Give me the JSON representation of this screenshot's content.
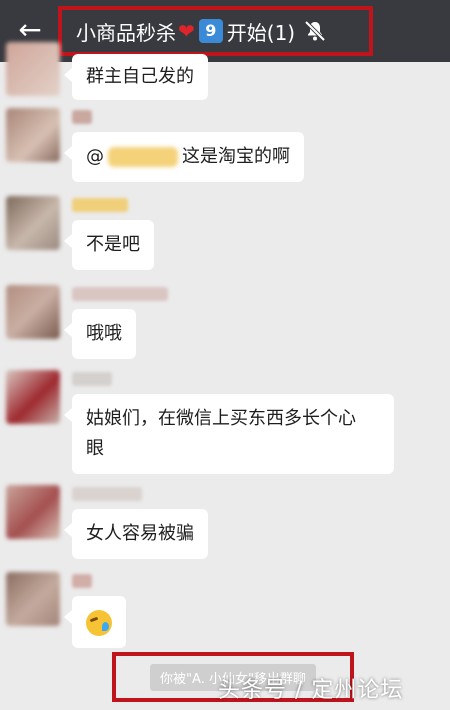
{
  "header": {
    "back_icon": "arrow-left-icon",
    "title_part1": "小商品秒杀",
    "heart": "❤",
    "badge_number": "9",
    "title_part2": "开始(1)",
    "mute_icon": "bell-off-icon",
    "bg_color": "#393a3f",
    "highlight_color": "#c0141c"
  },
  "messages": [
    {
      "text": "群主自己发的"
    },
    {
      "prefix": "@",
      "suffix": "这是淘宝的啊"
    },
    {
      "text": "不是吧"
    },
    {
      "text": "哦哦"
    },
    {
      "line1": "姑娘们，在微信上买东西多长个心",
      "line2": "眼"
    },
    {
      "text": "女人容易被骗"
    },
    {
      "emoji": "laugh-cry-emoji"
    }
  ],
  "system_notice": {
    "text": "你被\"A. 小仙女\"移出群聊"
  },
  "watermark": {
    "text": "头条号 / 定州论坛"
  }
}
